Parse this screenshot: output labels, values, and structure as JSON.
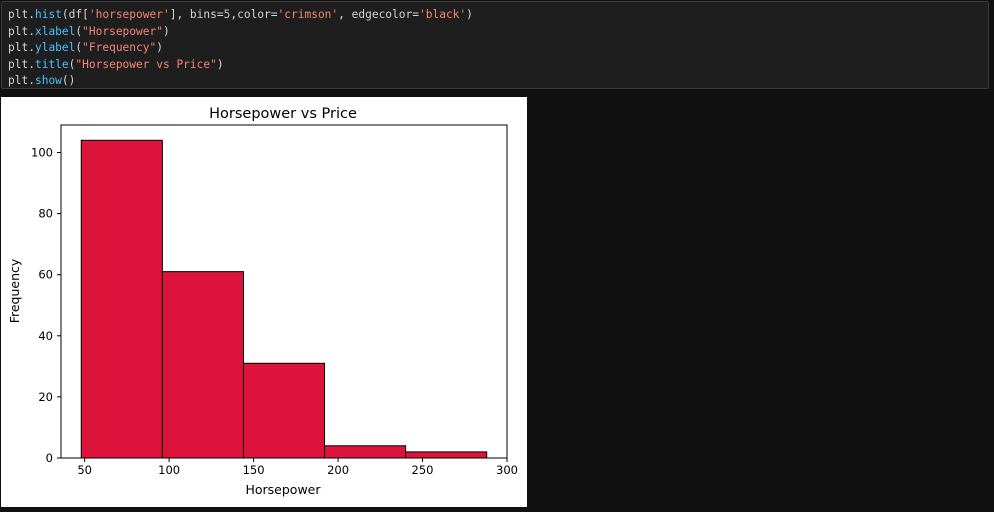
{
  "code": {
    "lines": [
      [
        {
          "t": "plt",
          "c": "obj"
        },
        {
          "t": ".",
          "c": "punc"
        },
        {
          "t": "hist",
          "c": "fn"
        },
        {
          "t": "(df[",
          "c": "punc"
        },
        {
          "t": "'horsepower'",
          "c": "str"
        },
        {
          "t": "], bins",
          "c": "punc"
        },
        {
          "t": "=",
          "c": "op"
        },
        {
          "t": "5",
          "c": "num"
        },
        {
          "t": ",color",
          "c": "punc"
        },
        {
          "t": "=",
          "c": "op"
        },
        {
          "t": "'crimson'",
          "c": "str"
        },
        {
          "t": ", edgecolor",
          "c": "punc"
        },
        {
          "t": "=",
          "c": "op"
        },
        {
          "t": "'black'",
          "c": "str"
        },
        {
          "t": ")",
          "c": "punc"
        }
      ],
      [
        {
          "t": "plt",
          "c": "obj"
        },
        {
          "t": ".",
          "c": "punc"
        },
        {
          "t": "xlabel",
          "c": "fn"
        },
        {
          "t": "(",
          "c": "punc"
        },
        {
          "t": "\"Horsepower\"",
          "c": "str"
        },
        {
          "t": ")",
          "c": "punc"
        }
      ],
      [
        {
          "t": "plt",
          "c": "obj"
        },
        {
          "t": ".",
          "c": "punc"
        },
        {
          "t": "ylabel",
          "c": "fn"
        },
        {
          "t": "(",
          "c": "punc"
        },
        {
          "t": "\"Frequency\"",
          "c": "str"
        },
        {
          "t": ")",
          "c": "punc"
        }
      ],
      [
        {
          "t": "plt",
          "c": "obj"
        },
        {
          "t": ".",
          "c": "punc"
        },
        {
          "t": "title",
          "c": "fn"
        },
        {
          "t": "(",
          "c": "punc"
        },
        {
          "t": "\"Horsepower vs Price\"",
          "c": "str"
        },
        {
          "t": ")",
          "c": "punc"
        }
      ],
      [
        {
          "t": "plt",
          "c": "obj"
        },
        {
          "t": ".",
          "c": "punc"
        },
        {
          "t": "show",
          "c": "fn"
        },
        {
          "t": "()",
          "c": "punc"
        }
      ]
    ]
  },
  "chart_data": {
    "type": "bar",
    "title": "Horsepower vs Price",
    "xlabel": "Horsepower",
    "ylabel": "Frequency",
    "bins": [
      {
        "x0": 48,
        "x1": 96,
        "count": 104
      },
      {
        "x0": 96,
        "x1": 144,
        "count": 61
      },
      {
        "x0": 144,
        "x1": 192,
        "count": 31
      },
      {
        "x0": 192,
        "x1": 240,
        "count": 4
      },
      {
        "x0": 240,
        "x1": 288,
        "count": 2
      }
    ],
    "xlim": [
      36,
      300
    ],
    "ylim": [
      0,
      109
    ],
    "xticks": [
      50,
      100,
      150,
      200,
      250,
      300
    ],
    "yticks": [
      0,
      20,
      40,
      60,
      80,
      100
    ],
    "bar_color": "#dc143c",
    "edge_color": "#000000",
    "grid": false
  }
}
